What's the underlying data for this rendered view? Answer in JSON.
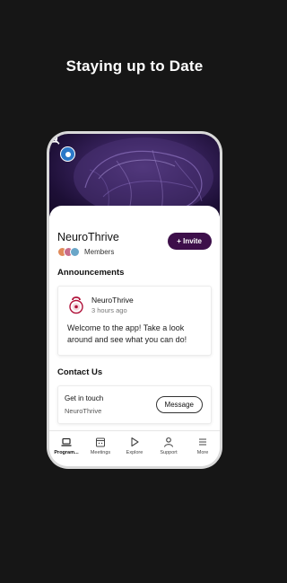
{
  "promo": {
    "title": "Staying up to Date"
  },
  "community": {
    "name": "NeuroThrive",
    "members_label": "Members",
    "invite_label": "+ Invite"
  },
  "announcements": {
    "section_title": "Announcements",
    "post": {
      "author": "NeuroThrive",
      "time": "3 hours ago",
      "body": "Welcome to the app! Take a look around and see what you can do!"
    }
  },
  "contact": {
    "section_title": "Contact Us",
    "heading": "Get in touch",
    "subtitle": "NeuroThrive",
    "button_label": "Message"
  },
  "tabs": [
    {
      "label": "Program...",
      "icon": "laptop-icon",
      "active": true
    },
    {
      "label": "Meetings",
      "icon": "calendar-icon",
      "active": false
    },
    {
      "label": "Explore",
      "icon": "play-icon",
      "active": false
    },
    {
      "label": "Support",
      "icon": "person-icon",
      "active": false
    },
    {
      "label": "More",
      "icon": "menu-icon",
      "active": false
    }
  ],
  "colors": {
    "background": "#161616",
    "accent": "#3d0f4a",
    "hero": "#3a2460"
  }
}
